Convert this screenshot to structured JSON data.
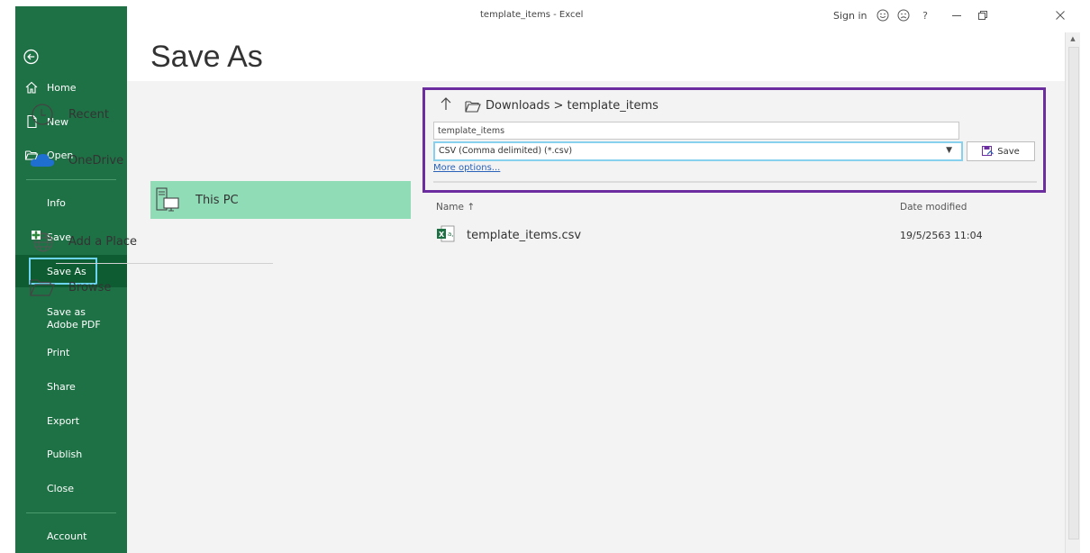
{
  "titlebar": {
    "title": "template_items  -  Excel",
    "sign_in": "Sign in",
    "help": "?"
  },
  "nav": {
    "items": [
      {
        "label": "Home",
        "icon": "home-icon"
      },
      {
        "label": "New",
        "icon": "new-document-icon"
      },
      {
        "label": "Open",
        "icon": "open-folder-icon"
      },
      {
        "label": "Info"
      },
      {
        "label": "Save"
      },
      {
        "label": "Save As"
      },
      {
        "label": "Save as Adobe PDF"
      },
      {
        "label": "Print"
      },
      {
        "label": "Share"
      },
      {
        "label": "Export"
      },
      {
        "label": "Publish"
      },
      {
        "label": "Close"
      },
      {
        "label": "Account"
      }
    ],
    "selected": "Save As",
    "accent": "#1e7145"
  },
  "heading": "Save As",
  "places": [
    {
      "label": "Recent",
      "icon": "clock-icon"
    },
    {
      "label": "OneDrive",
      "icon": "cloud-icon"
    },
    {
      "label": "This PC",
      "icon": "computer-icon",
      "selected": true
    },
    {
      "label": "Add a Place",
      "icon": "globe-plus-icon"
    },
    {
      "label": "Browse",
      "icon": "folder-icon"
    }
  ],
  "save_panel": {
    "breadcrumb": "Downloads > template_items",
    "filename": "template_items",
    "filetype": "CSV (Comma delimited) (*.csv)",
    "more_options": "More options...",
    "save_label": "Save"
  },
  "file_list": {
    "columns": {
      "name": "Name ↑",
      "date": "Date modified"
    },
    "rows": [
      {
        "name": "template_items.csv",
        "date": "19/5/2563 11:04"
      }
    ]
  },
  "colors": {
    "highlight_border": "#6b2da0",
    "selected_place": "#8fdcb7",
    "focus_ring": "#6cd4f0"
  }
}
